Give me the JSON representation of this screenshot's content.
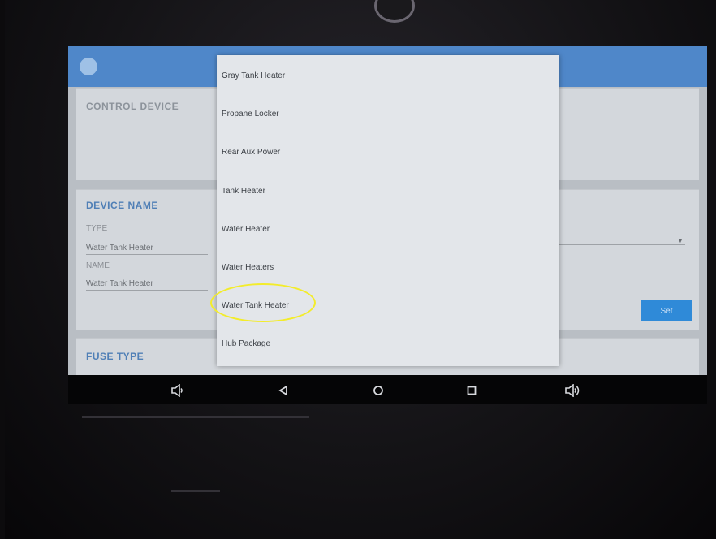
{
  "app": {
    "title": "",
    "subtitle": ""
  },
  "control_card": {
    "title": "CONTROL DEVICE"
  },
  "device_card": {
    "title": "DEVICE NAME",
    "type_label": "TYPE",
    "type_value": "Water Tank Heater",
    "name_label": "NAME",
    "name_value": "Water Tank Heater",
    "save_label": "Set"
  },
  "fuse_card": {
    "title": "FUSE TYPE"
  },
  "dialog": {
    "items": [
      {
        "label": "Gray Tank Heater"
      },
      {
        "label": "Propane Locker"
      },
      {
        "label": "Rear Aux Power"
      },
      {
        "label": "Tank Heater"
      },
      {
        "label": "Water Heater"
      },
      {
        "label": "Water Heaters"
      },
      {
        "label": "Water Tank Heater"
      },
      {
        "label": "Hub Package"
      }
    ],
    "highlighted_item": "Water Tank Heater",
    "highlight_color": "#f3ec2b"
  },
  "navbar": {
    "buttons": [
      "volume-down-icon",
      "back-icon",
      "home-icon",
      "recents-icon",
      "volume-up-icon"
    ]
  },
  "colors": {
    "header": "#4f87c9",
    "accent": "#4f7fb6",
    "button": "#2f8ad8"
  }
}
